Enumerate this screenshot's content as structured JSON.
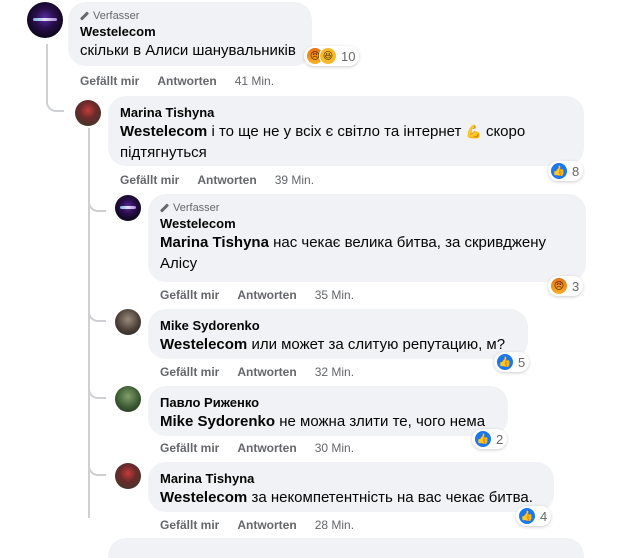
{
  "comments": [
    {
      "badge": "Verfasser",
      "author": "Westelecom",
      "text": "скільки в Алиси шанувальників",
      "reaction_count": "10",
      "reactions": [
        "angry-icon",
        "haha-icon"
      ],
      "like_label": "Gefällt mir",
      "reply_label": "Antworten",
      "time": "41 Min."
    },
    {
      "author": "Marina Tishyna",
      "mention": "Westelecom",
      "text": "і то ще не у всіх є світло та інтернет",
      "emoji": "💪",
      "text2": "скоро",
      "text3": "підтягнуться",
      "reaction_count": "8",
      "like_label": "Gefällt mir",
      "reply_label": "Antworten",
      "time": "39 Min."
    },
    {
      "badge": "Verfasser",
      "author": "Westelecom",
      "mention": "Marina Tishyna",
      "text": "нас чекає велика битва, за скривджену",
      "text2": "Алісу",
      "reaction_count": "3",
      "like_label": "Gefällt mir",
      "reply_label": "Antworten",
      "time": "35 Min."
    },
    {
      "author": "Mike Sydorenko",
      "mention": "Westelecom",
      "text": "или может за слитую репутацию, м?",
      "reaction_count": "5",
      "like_label": "Gefällt mir",
      "reply_label": "Antworten",
      "time": "32 Min."
    },
    {
      "author": "Павло Риженко",
      "mention": "Mike Sydorenko",
      "text": "не можна злити те, чого нема",
      "reaction_count": "2",
      "like_label": "Gefällt mir",
      "reply_label": "Antworten",
      "time": "30 Min."
    },
    {
      "author": "Marina Tishyna",
      "mention": "Westelecom",
      "text": "за некомпетентність на вас чекає битва.",
      "reaction_count": "4",
      "like_label": "Gefällt mir",
      "reply_label": "Antworten",
      "time": "28 Min."
    }
  ],
  "colors": {
    "bubble": "#f0f2f5",
    "meta": "#65676b",
    "like": "#1877f2",
    "thread_line": "#ced0d4"
  }
}
